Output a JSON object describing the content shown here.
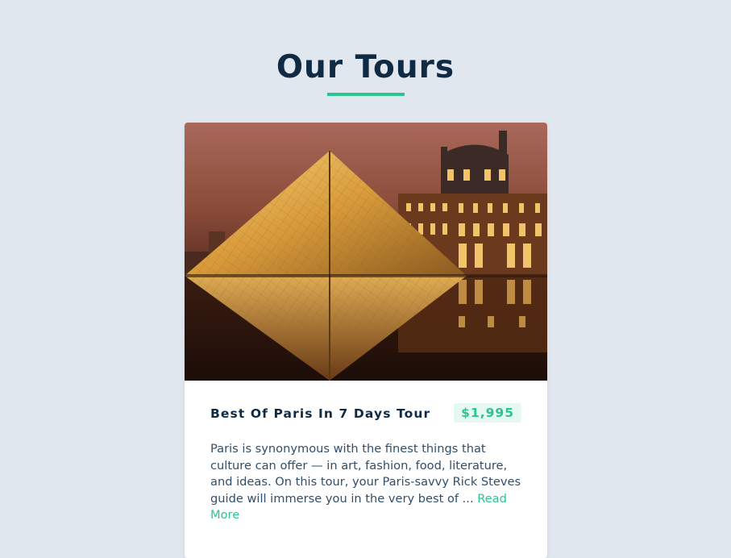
{
  "section": {
    "title": "Our Tours"
  },
  "tour": {
    "name": "Best Of Paris In 7 Days Tour",
    "price": "$1,995",
    "description": "Paris is synonymous with the finest things that culture can offer — in art, fashion, food, literature, and ideas. On this tour, your Paris-savvy Rick Steves guide will immerse you in the very best of ...",
    "read_more": "Read More",
    "image_alt": "Louvre pyramid at night"
  },
  "colors": {
    "accent": "#2cc58f",
    "heading": "#102a43",
    "background": "#e1e7ef"
  }
}
